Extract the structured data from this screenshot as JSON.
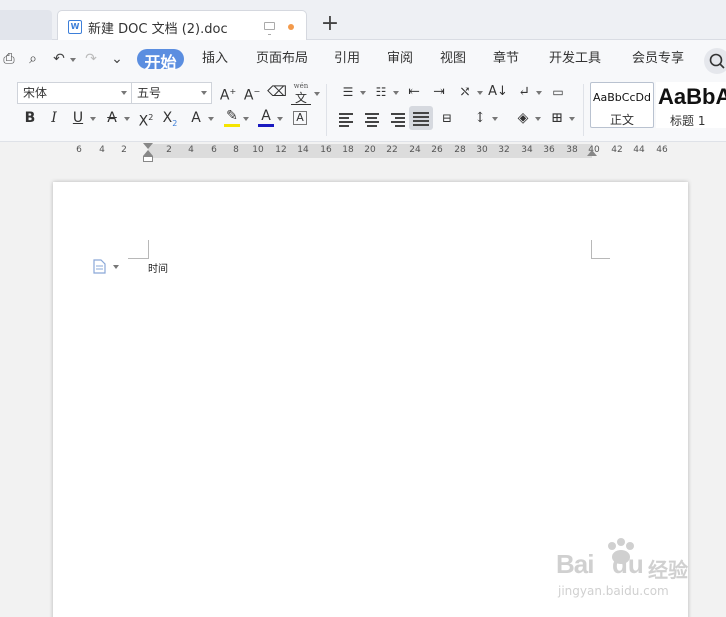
{
  "tabs": {
    "doc_title": "新建 DOC 文档 (2).doc",
    "word_icon": "W"
  },
  "menu": {
    "items": [
      "开始",
      "插入",
      "页面布局",
      "引用",
      "审阅",
      "视图",
      "章节",
      "开发工具",
      "会员专享"
    ]
  },
  "ribbon": {
    "font_name": "宋体",
    "font_size": "五号",
    "styles": {
      "normal_preview": "AaBbCcDd",
      "normal_label": "正文",
      "heading_preview": "AaBbA",
      "heading_label": "标题 1"
    },
    "phonetic": "wén",
    "phonetic_char": "文"
  },
  "ruler": {
    "labels": [
      "6",
      "4",
      "2",
      "2",
      "4",
      "6",
      "8",
      "10",
      "12",
      "14",
      "16",
      "18",
      "20",
      "22",
      "24",
      "26",
      "28",
      "30",
      "32",
      "34",
      "36",
      "38",
      "40",
      "42",
      "44",
      "46"
    ]
  },
  "document": {
    "text": "时间"
  },
  "watermark": {
    "brand": "Bai",
    "brand2": "du",
    "suffix": "经验",
    "url": "jingyan.baidu.com"
  },
  "colors": {
    "accent": "#5b8ee0",
    "highlight": "#f5e400",
    "font_color": "#1a1ac0",
    "modified_dot": "#f39a4b"
  },
  "icons": [
    "print-icon",
    "print-preview-icon",
    "undo-icon",
    "redo-icon",
    "more-icon",
    "search-icon",
    "word-doc-icon",
    "monitor-icon",
    "add-tab-icon"
  ]
}
